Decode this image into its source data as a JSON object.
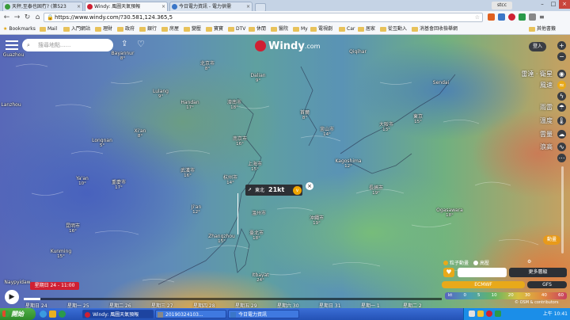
{
  "browser": {
    "tabs": [
      {
        "label": "天秤,至泰也固冇? (第523",
        "icon_color": "#3a9b3a"
      },
      {
        "label": "Windy: 風圖天氣預報",
        "icon_color": "#cf2033"
      },
      {
        "label": "今日電力資訊 - 電力供需",
        "icon_color": "#3a76c8"
      }
    ],
    "user_badge": "stcc",
    "nav": {
      "back_icon": "back-arrow-icon",
      "forward_icon": "forward-arrow-icon",
      "reload_icon": "reload-icon",
      "home_icon": "home-icon"
    },
    "url": "https://www.windy.com/?30.581,124.365,5",
    "bookmarks_label": "Bookmarks",
    "bookmarks": [
      "Mail",
      "入門網站",
      "理財",
      "政府",
      "銀行",
      "房屋",
      "變壓",
      "寶寶",
      "DTV",
      "休閒",
      "醫院",
      "My",
      "電視劇",
      "Car",
      "居家",
      "從互動入",
      "消基會回收檢舉網"
    ],
    "other_bookmarks": "其他書籤"
  },
  "map": {
    "search_placeholder": "搜尋地點......",
    "logo_text": "Windy",
    "logo_suffix": ".com",
    "login_label": "登入",
    "layers": [
      "雷達 · 衛星",
      "風速",
      "雨雷",
      "溫度",
      "雲量",
      "浪高"
    ],
    "right_icons": [
      "plus-icon",
      "minus-icon",
      "wind-icon",
      "rain-icon",
      "temperature-icon",
      "cloud-icon",
      "waves-icon",
      "more-icon"
    ],
    "weather_pin": {
      "direction": "東北",
      "speed": "21kt",
      "badge": "v"
    },
    "animation_label": "動畫",
    "cities": [
      {
        "name": "Guazhou",
        "temp": ""
      },
      {
        "name": "Bayannur",
        "temp": "8°"
      },
      {
        "name": "北京市",
        "temp": "8°"
      },
      {
        "name": "Dalian",
        "temp": "9°"
      },
      {
        "name": "Qiqihar",
        "temp": ""
      },
      {
        "name": "Sendai",
        "temp": ""
      },
      {
        "name": "東京",
        "temp": "15°"
      },
      {
        "name": "大阪市",
        "temp": "13°"
      },
      {
        "name": "首爾",
        "temp": "8°"
      },
      {
        "name": "釜山市",
        "temp": "14°"
      },
      {
        "name": "Kagoshima",
        "temp": "12°"
      },
      {
        "name": "Ogasawara",
        "temp": "18°"
      },
      {
        "name": "Lanzhou",
        "temp": ""
      },
      {
        "name": "Lulang",
        "temp": "9°"
      },
      {
        "name": "Handan",
        "temp": "17°"
      },
      {
        "name": "濟南市",
        "temp": "18°"
      },
      {
        "name": "Xi'an",
        "temp": "8°"
      },
      {
        "name": "Longnan",
        "temp": "5°"
      },
      {
        "name": "南京市",
        "temp": "16°"
      },
      {
        "name": "上海市",
        "temp": "15°"
      },
      {
        "name": "Ya'an",
        "temp": "10°"
      },
      {
        "name": "重慶市",
        "temp": "17°"
      },
      {
        "name": "武漢市",
        "temp": "16°"
      },
      {
        "name": "杭州市",
        "temp": "14°"
      },
      {
        "name": "臺北市",
        "temp": "18°"
      },
      {
        "name": "Zhangzhou",
        "temp": "15°"
      },
      {
        "name": "Kunming",
        "temp": "15°"
      },
      {
        "name": "昆明市",
        "temp": "16°"
      },
      {
        "name": "溫州市",
        "temp": ""
      },
      {
        "name": "Ji'an",
        "temp": "12°"
      },
      {
        "name": "Itbayat",
        "temp": "24°"
      },
      {
        "name": "Naypyidaw",
        "temp": ""
      },
      {
        "name": "沖繩市",
        "temp": "19°"
      },
      {
        "name": "長崎市",
        "temp": "19°"
      }
    ],
    "timeline": {
      "current_time": "星期日 24 - 11:00",
      "progress": 0.04,
      "days": [
        "星期日 24",
        "星期一 25",
        "星期二 26",
        "星期三 27",
        "星期四 28",
        "星期五 29",
        "星期六 30",
        "星期日 31",
        "星期一 1",
        "星期二 2"
      ]
    },
    "model_panel": {
      "options": [
        "粒子動畫",
        "高壓"
      ],
      "more_label": "更多層級",
      "ecmwf_label": "ECMWF",
      "gfs_label": "GFS",
      "legend_unit": "kt",
      "legend_values": [
        "0",
        "5",
        "10",
        "20",
        "30",
        "40",
        "60"
      ],
      "attribution": "© OSM & contributors"
    }
  },
  "taskbar": {
    "start_label": "開始",
    "tasks": [
      "Windy: 風圖天氣預報",
      "20190324103...",
      "今日電力資訊"
    ],
    "clock": "上午 10:41"
  }
}
